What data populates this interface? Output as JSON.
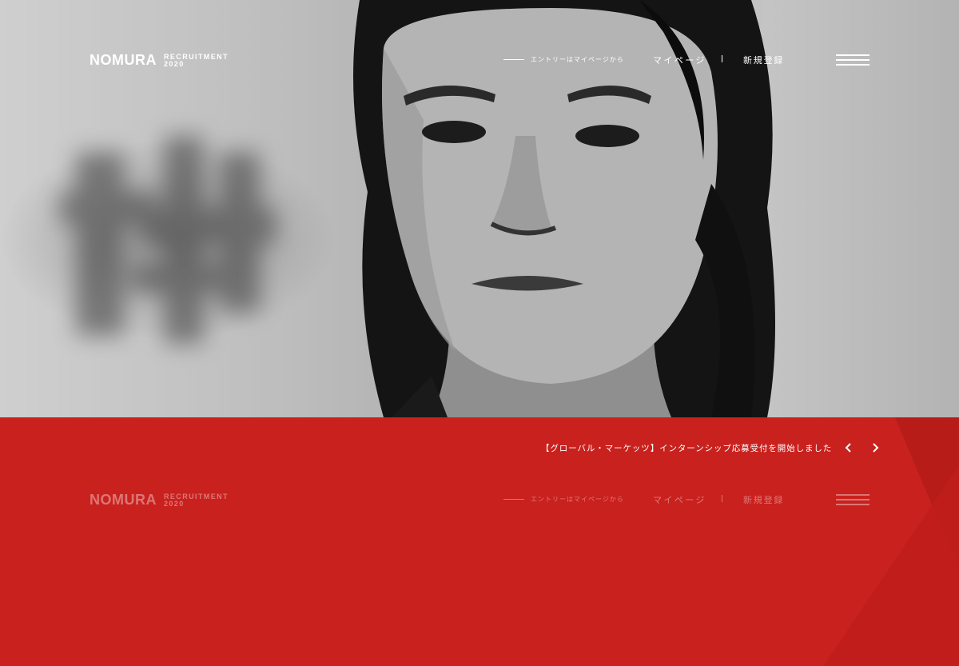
{
  "brand": {
    "logo_text": "NOMURA",
    "sub_line1": "RECRUITMENT",
    "sub_line2": "2020"
  },
  "nav": {
    "entry_text": "エントリーはマイページから",
    "mypage_label": "マイページ",
    "separator": "|",
    "register_label": "新規登録"
  },
  "news": {
    "headline": "【グローバル・マーケッツ】インターンシップ応募受付を開始しました"
  },
  "colors": {
    "brand_red": "#c9211e",
    "text_white": "#ffffff"
  },
  "icons": {
    "menu": "hamburger-menu-icon",
    "prev": "chevron-left-icon",
    "next": "chevron-right-icon"
  }
}
